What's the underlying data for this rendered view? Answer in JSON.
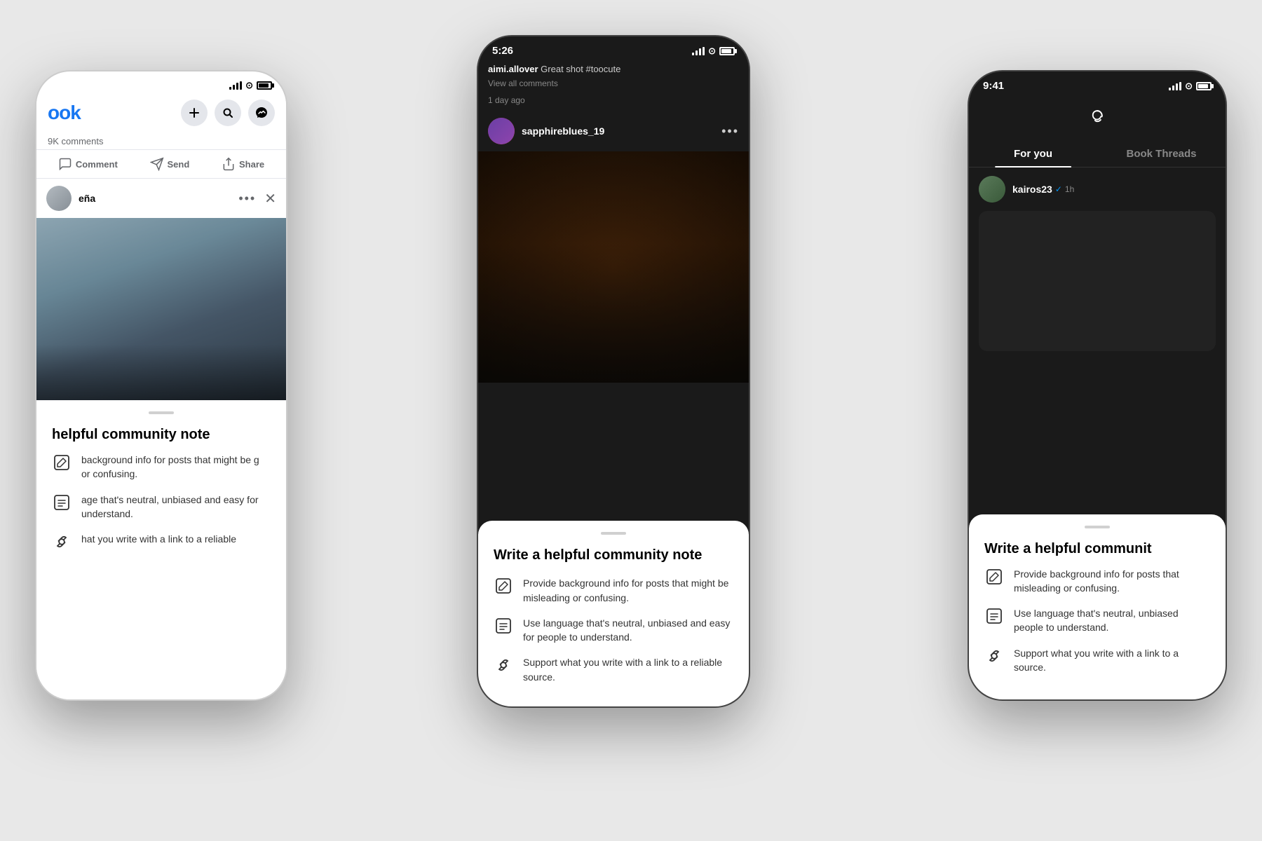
{
  "background_color": "#e8e8e8",
  "phones": {
    "left": {
      "app": "Facebook",
      "status_bar": {
        "time": "",
        "has_signal": true,
        "has_wifi": true,
        "has_battery": true
      },
      "logo": "ook",
      "comments_count": "9K comments",
      "actions": {
        "comment": "Comment",
        "send": "Send",
        "share": "Share"
      },
      "post_username_partial": "eña",
      "bottom_sheet": {
        "handle": true,
        "title_partial": "helpful community note",
        "items": [
          {
            "icon": "edit",
            "text": "background info for posts that might be g or confusing."
          },
          {
            "icon": "list",
            "text": "age that's neutral, unbiased and easy for understand."
          },
          {
            "icon": "link",
            "text": "hat you write with a link to a reliable"
          }
        ]
      }
    },
    "center": {
      "app": "Instagram",
      "status_bar": {
        "time": "5:26",
        "has_signal": true,
        "has_wifi": true,
        "has_battery": true,
        "battery_color": "dark"
      },
      "comment_preview": {
        "username": "aimi.allover",
        "text": "Great shot #toocute"
      },
      "view_comments": "View all comments",
      "timestamp": "1 day ago",
      "post_username": "sapphireblues_19",
      "bottom_sheet": {
        "handle": true,
        "title": "Write a helpful community note",
        "items": [
          {
            "icon": "edit",
            "text": "Provide background info for posts that might be misleading or confusing."
          },
          {
            "icon": "list",
            "text": "Use language that's neutral, unbiased and easy for people to understand."
          },
          {
            "icon": "link",
            "text": "Support what you write with a link to a reliable source."
          }
        ]
      }
    },
    "right": {
      "app": "Threads",
      "status_bar": {
        "time": "9:41",
        "has_signal": true,
        "has_wifi": true,
        "has_battery": true,
        "battery_color": "dark"
      },
      "tabs": [
        {
          "label": "For you",
          "active": true
        },
        {
          "label": "Book Threads",
          "active": false
        }
      ],
      "post_username": "kairos23",
      "verified": true,
      "post_time": "1h",
      "bottom_sheet": {
        "handle": true,
        "title_partial": "Write a helpful communit",
        "items": [
          {
            "icon": "edit",
            "text": "Provide background info for posts that misleading or confusing."
          },
          {
            "icon": "list",
            "text": "Use language that's neutral, unbiased people to understand."
          },
          {
            "icon": "link",
            "text": "Support what you write with a link to a source."
          }
        ]
      }
    }
  }
}
